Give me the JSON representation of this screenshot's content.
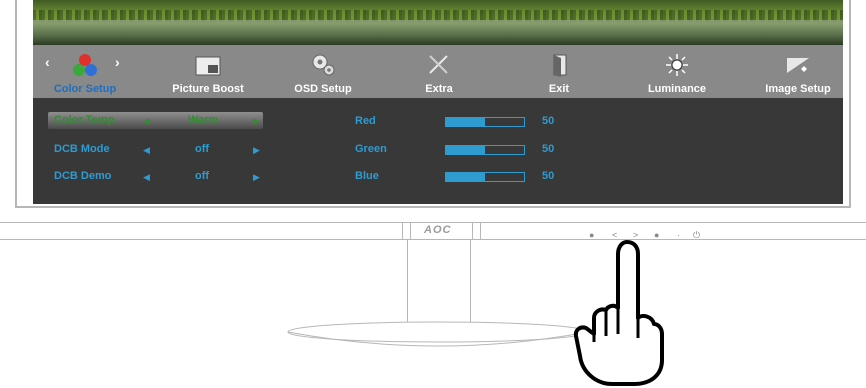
{
  "menu": {
    "items": [
      {
        "label": "Color Setup",
        "icon": "color-balls-icon",
        "active": true
      },
      {
        "label": "Picture Boost",
        "icon": "picture-boost-icon"
      },
      {
        "label": "OSD Setup",
        "icon": "gears-icon"
      },
      {
        "label": "Extra",
        "icon": "tools-icon"
      },
      {
        "label": "Exit",
        "icon": "door-exit-icon"
      },
      {
        "label": "Luminance",
        "icon": "sun-icon"
      },
      {
        "label": "Image Setup",
        "icon": "image-setup-icon"
      }
    ]
  },
  "settings": {
    "rows": [
      {
        "label": "Color Temp.",
        "value": "Warm"
      },
      {
        "label": "DCB Mode",
        "value": "off"
      },
      {
        "label": "DCB Demo",
        "value": "off"
      }
    ]
  },
  "rgb": {
    "rows": [
      {
        "label": "Red",
        "value": "50",
        "level": 0.5
      },
      {
        "label": "Green",
        "value": "50",
        "level": 0.5
      },
      {
        "label": "Blue",
        "value": "50",
        "level": 0.5
      }
    ]
  },
  "brand": "AOC",
  "colors": {
    "accent": "#2e9bd1",
    "active_label": "#1e6fbf",
    "highlight_text": "#2f8f2f"
  }
}
